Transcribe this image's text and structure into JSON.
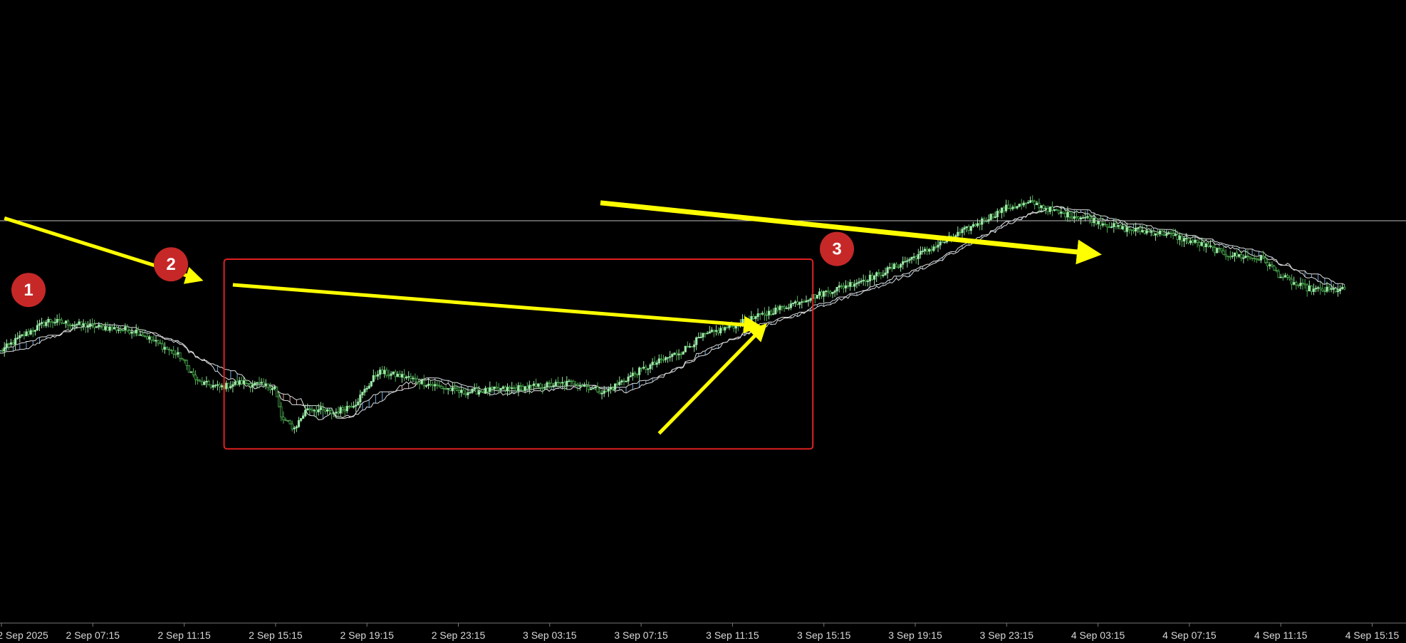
{
  "chart_data": {
    "type": "candlestick",
    "title": "",
    "xlabel": "",
    "ylabel": "",
    "ylim": [
      0,
      1
    ],
    "x_tick_labels": [
      "2 Sep 2025",
      "2 Sep 07:15",
      "2 Sep 11:15",
      "2 Sep 15:15",
      "2 Sep 19:15",
      "2 Sep 23:15",
      "3 Sep 03:15",
      "3 Sep 07:15",
      "3 Sep 11:15",
      "3 Sep 15:15",
      "3 Sep 19:15",
      "3 Sep 23:15",
      "4 Sep 03:15",
      "4 Sep 07:15",
      "4 Sep 11:15",
      "4 Sep 15:15"
    ],
    "close_path": [
      [
        0,
        0.37
      ],
      [
        10,
        0.4
      ],
      [
        22,
        0.43
      ],
      [
        40,
        0.42
      ],
      [
        62,
        0.41
      ],
      [
        70,
        0.39
      ],
      [
        82,
        0.36
      ],
      [
        90,
        0.31
      ],
      [
        100,
        0.3
      ],
      [
        110,
        0.31
      ],
      [
        125,
        0.3
      ],
      [
        128,
        0.24
      ],
      [
        134,
        0.22
      ],
      [
        140,
        0.26
      ],
      [
        152,
        0.25
      ],
      [
        162,
        0.27
      ],
      [
        172,
        0.33
      ],
      [
        185,
        0.32
      ],
      [
        192,
        0.31
      ],
      [
        210,
        0.29
      ],
      [
        240,
        0.3
      ],
      [
        262,
        0.31
      ],
      [
        275,
        0.29
      ],
      [
        290,
        0.33
      ],
      [
        310,
        0.37
      ],
      [
        320,
        0.4
      ],
      [
        340,
        0.43
      ],
      [
        365,
        0.47
      ],
      [
        400,
        0.52
      ],
      [
        428,
        0.58
      ],
      [
        445,
        0.62
      ],
      [
        458,
        0.65
      ],
      [
        470,
        0.66
      ],
      [
        482,
        0.64
      ],
      [
        495,
        0.63
      ],
      [
        510,
        0.61
      ],
      [
        530,
        0.6
      ],
      [
        546,
        0.58
      ],
      [
        558,
        0.56
      ],
      [
        575,
        0.55
      ],
      [
        582,
        0.52
      ],
      [
        590,
        0.5
      ],
      [
        598,
        0.49
      ],
      [
        612,
        0.49
      ]
    ],
    "red_box": {
      "x": [
        102,
        370
      ],
      "y": [
        0.18,
        0.55
      ]
    },
    "horizontal_line_y": 0.625,
    "annotations": [
      {
        "label": "1",
        "x": 40,
        "y": 0.49
      },
      {
        "label": "2",
        "x": 240,
        "y": 0.54
      },
      {
        "label": "3",
        "x": 1175,
        "y": 0.57
      }
    ],
    "arrows": [
      {
        "from": [
          2,
          0.63
        ],
        "to": [
          91,
          0.51
        ]
      },
      {
        "from": [
          106,
          0.5
        ],
        "to": [
          345,
          0.42
        ]
      },
      {
        "from": [
          300,
          0.21
        ],
        "to": [
          348,
          0.42
        ]
      },
      {
        "from": [
          843,
          0.66
        ],
        "to": [
          1540,
          0.56
        ]
      }
    ],
    "colors": {
      "background": "#000000",
      "bull_candle": "#9be8a6",
      "bear_candle": "#4caf50",
      "cloud_bull": "#6fa8dc",
      "cloud_bear": "#e6a8a8",
      "arrow": "#ffff00",
      "box": "#e02020",
      "badge": "#c62828",
      "level_line": "#bbbbbb"
    }
  }
}
